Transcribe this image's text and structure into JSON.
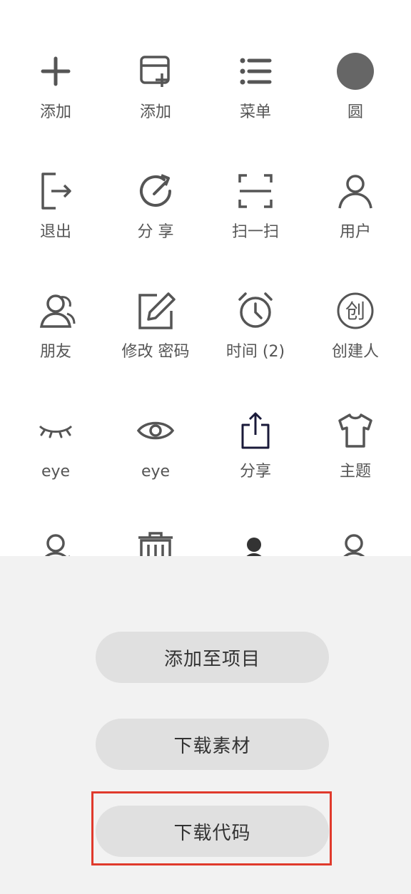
{
  "grid": {
    "row1": [
      "添加",
      "添加",
      "菜单",
      "圆"
    ],
    "row2": [
      "退出",
      "分 享",
      "扫一扫",
      "用户"
    ],
    "row3": [
      "朋友",
      "修改 密码",
      "时间 (2)",
      "创建人"
    ],
    "row4": [
      "eye",
      "eye",
      "分享",
      "主题"
    ]
  },
  "icons": {
    "row1": [
      "plus-icon",
      "add-window-icon",
      "list-menu-icon",
      "filled-circle-icon"
    ],
    "row2": [
      "logout-icon",
      "share-rotate-icon",
      "scan-icon",
      "user-icon"
    ],
    "row3": [
      "friends-icon",
      "edit-password-icon",
      "alarm-clock-icon",
      "create-person-icon"
    ],
    "row4": [
      "eye-closed-icon",
      "eye-open-icon",
      "share-upload-icon",
      "theme-shirt-icon"
    ],
    "row5": [
      "user-transfer-icon",
      "trash-icon",
      "user-export-icon",
      "user-arrow-icon"
    ]
  },
  "sheet": {
    "add_to_project": "添加至项目",
    "download_material": "下载素材",
    "download_code": "下载代码"
  },
  "colors": {
    "icon": "#555555",
    "sheet_bg": "#f2f2f2",
    "button_bg": "#e0e0e0",
    "highlight": "#e03a2c",
    "share_upload": "#1a1a3a"
  }
}
